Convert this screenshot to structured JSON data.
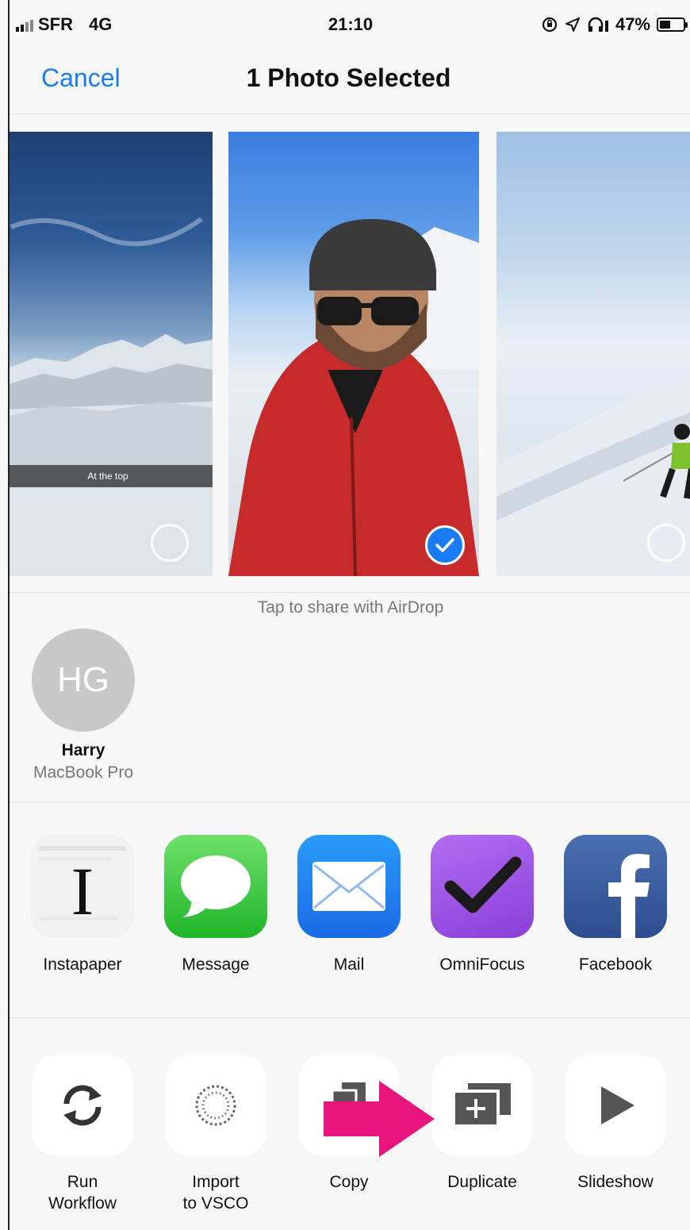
{
  "status_bar": {
    "carrier": "SFR",
    "network": "4G",
    "time": "21:10",
    "battery": "47%",
    "battery_level": 0.47
  },
  "nav": {
    "cancel_label": "Cancel",
    "title": "1 Photo Selected"
  },
  "photos": [
    {
      "caption": "At the top",
      "selected": false
    },
    {
      "caption": "",
      "selected": true
    },
    {
      "caption": "",
      "selected": false
    }
  ],
  "airdrop": {
    "label": "Tap to share with AirDrop",
    "contacts": [
      {
        "initials": "HG",
        "name": "Harry",
        "device": "MacBook Pro"
      }
    ]
  },
  "share_apps": [
    {
      "label": "Instapaper",
      "icon": "instapaper-icon"
    },
    {
      "label": "Message",
      "icon": "message-icon"
    },
    {
      "label": "Mail",
      "icon": "mail-icon"
    },
    {
      "label": "OmniFocus",
      "icon": "omnifocus-icon"
    },
    {
      "label": "Facebook",
      "icon": "facebook-icon"
    }
  ],
  "actions": [
    {
      "label_line1": "Run",
      "label_line2": "Workflow",
      "icon": "refresh-icon"
    },
    {
      "label_line1": "Import",
      "label_line2": "to VSCO",
      "icon": "vsco-icon"
    },
    {
      "label_line1": "Copy",
      "label_line2": "",
      "icon": "copy-icon"
    },
    {
      "label_line1": "Duplicate",
      "label_line2": "",
      "icon": "duplicate-icon"
    },
    {
      "label_line1": "Slideshow",
      "label_line2": "",
      "icon": "play-icon"
    }
  ],
  "colors": {
    "accent": "#1a7cf5",
    "highlight_arrow": "#e8157f"
  }
}
